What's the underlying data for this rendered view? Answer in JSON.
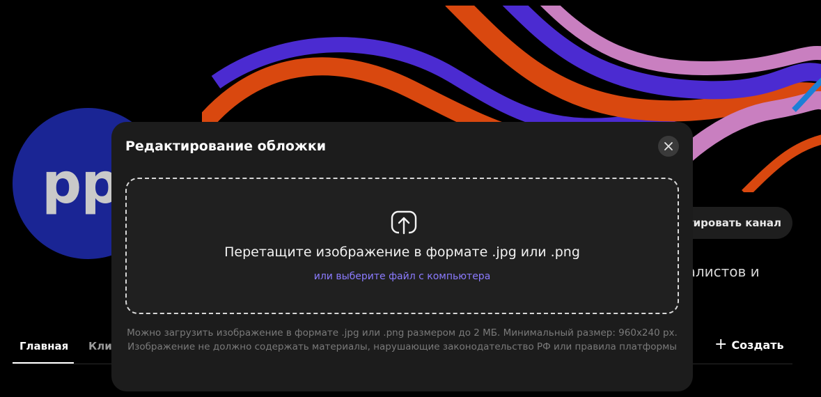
{
  "header": {
    "avatar_text": "pp",
    "edit_channel_label": "тировать канал",
    "description_fragment": "циалистов и"
  },
  "tabs": {
    "main_label": "Главная",
    "clips_label": "Кли"
  },
  "actions": {
    "create_label": "Создать"
  },
  "colors": {
    "avatar_bg": "#1a2594",
    "modal_bg": "#1c1c1c",
    "link": "#8b7bff",
    "banner_orange": "#d9480f",
    "banner_purple": "#4b2bd1",
    "banner_pink": "#c97fc0"
  },
  "modal": {
    "title": "Редактирование обложки",
    "close_icon": "close-icon",
    "upload_icon": "upload-icon",
    "drop_title": "Перетащите изображение в формате .jpg или .png",
    "drop_link": "или выберите файл с компьютера",
    "hint_line1": "Можно загрузить изображение в формате .jpg или .png размером до 2 МБ. Минимальный размер: 960x240 px.",
    "hint_line2": "Изображение не должно содержать материалы, нарушающие законодательство РФ или правила платформы"
  }
}
